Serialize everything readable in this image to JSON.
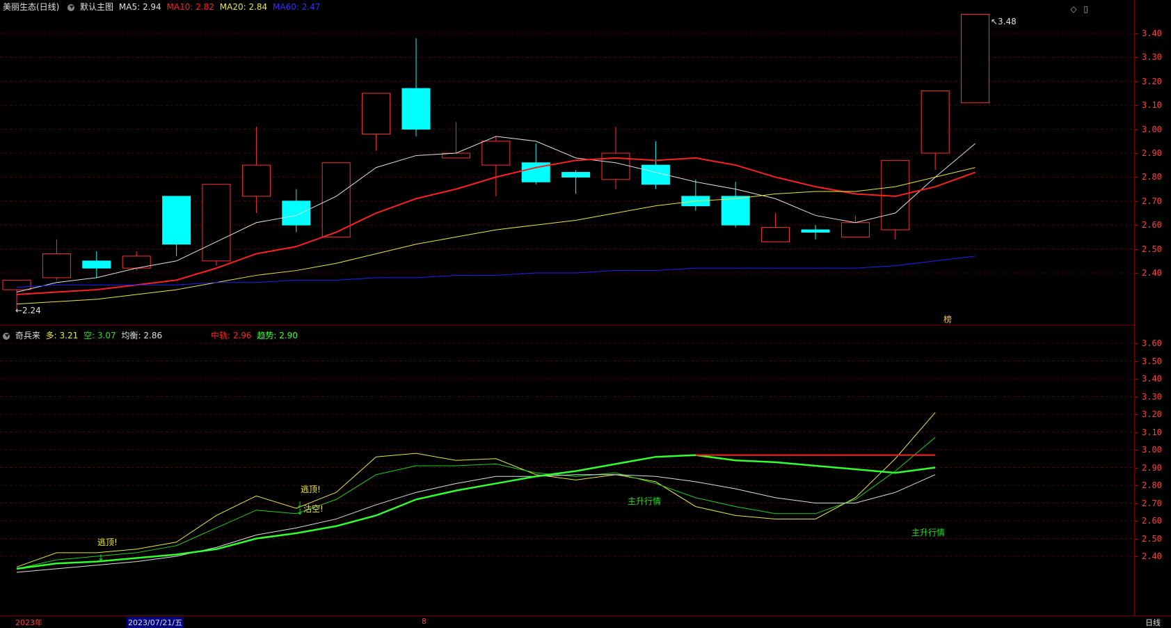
{
  "header": {
    "stock": "美丽生态(日线)",
    "template": "默认主图",
    "ma5_label": "MA5:",
    "ma5": "2.94",
    "ma10_label": "MA10:",
    "ma10": "2.82",
    "ma20_label": "MA20:",
    "ma20": "2.84",
    "ma60_label": "MA60:",
    "ma60": "2.47",
    "icons": [
      "diamond-icon",
      "window-icon"
    ]
  },
  "indicator_header": {
    "name": "奇兵来",
    "duo_label": "多:",
    "duo": "3.21",
    "kong_label": "空:",
    "kong": "3.07",
    "junheng_label": "均衡:",
    "junheng": "2.86",
    "zhonggui_label": "中轨:",
    "zhonggui": "2.96",
    "qushi_label": "趋势:",
    "qushi": "2.90"
  },
  "annotations": {
    "high_label": "3.48",
    "low_label": "2.24",
    "bang": "榜",
    "escape_top_1": "逃顶!",
    "escape_top_2": "逃顶!",
    "sell_short": "沽空!",
    "main_rise_1": "主升行情",
    "main_rise_2": "主升行情"
  },
  "footer": {
    "year": "2023年",
    "date": "2023/07/21/五",
    "month": "8",
    "period": "日线"
  },
  "colors": {
    "up": "#ff3030",
    "down": "#00ffff",
    "ma5": "#e0e0e0",
    "ma10": "#ff2020",
    "ma20": "#e8e840",
    "ma60": "#2020ff",
    "axis": "#ff4040"
  },
  "chart_data": [
    {
      "type": "candlestick",
      "ylim": [
        2.2,
        3.5
      ],
      "yticks": [
        "3.40",
        "3.30",
        "3.20",
        "3.10",
        "3.00",
        "2.90",
        "2.80",
        "2.70",
        "2.60",
        "2.50",
        "2.40"
      ],
      "candles": [
        {
          "o": 2.33,
          "h": 2.37,
          "l": 2.24,
          "c": 2.37
        },
        {
          "o": 2.38,
          "h": 2.54,
          "l": 2.37,
          "c": 2.48
        },
        {
          "o": 2.45,
          "h": 2.49,
          "l": 2.38,
          "c": 2.42
        },
        {
          "o": 2.42,
          "h": 2.49,
          "l": 2.41,
          "c": 2.47
        },
        {
          "o": 2.72,
          "h": 2.72,
          "l": 2.47,
          "c": 2.52
        },
        {
          "o": 2.45,
          "h": 2.77,
          "l": 2.43,
          "c": 2.77
        },
        {
          "o": 2.72,
          "h": 3.01,
          "l": 2.65,
          "c": 2.85
        },
        {
          "o": 2.7,
          "h": 2.75,
          "l": 2.57,
          "c": 2.6
        },
        {
          "o": 2.55,
          "h": 2.86,
          "l": 2.55,
          "c": 2.86
        },
        {
          "o": 2.98,
          "h": 3.15,
          "l": 2.91,
          "c": 3.15
        },
        {
          "o": 3.17,
          "h": 3.38,
          "l": 2.97,
          "c": 3.0
        },
        {
          "o": 2.88,
          "h": 3.03,
          "l": 2.88,
          "c": 2.9
        },
        {
          "o": 2.85,
          "h": 2.97,
          "l": 2.72,
          "c": 2.95
        },
        {
          "o": 2.86,
          "h": 2.94,
          "l": 2.77,
          "c": 2.78
        },
        {
          "o": 2.82,
          "h": 2.83,
          "l": 2.73,
          "c": 2.8
        },
        {
          "o": 2.79,
          "h": 3.01,
          "l": 2.75,
          "c": 2.9
        },
        {
          "o": 2.85,
          "h": 2.95,
          "l": 2.75,
          "c": 2.77
        },
        {
          "o": 2.72,
          "h": 2.79,
          "l": 2.66,
          "c": 2.68
        },
        {
          "o": 2.72,
          "h": 2.78,
          "l": 2.59,
          "c": 2.6
        },
        {
          "o": 2.53,
          "h": 2.65,
          "l": 2.53,
          "c": 2.59
        },
        {
          "o": 2.58,
          "h": 2.6,
          "l": 2.54,
          "c": 2.57
        },
        {
          "o": 2.55,
          "h": 2.64,
          "l": 2.55,
          "c": 2.61
        },
        {
          "o": 2.58,
          "h": 2.87,
          "l": 2.54,
          "c": 2.87
        },
        {
          "o": 2.9,
          "h": 3.16,
          "l": 2.83,
          "c": 3.16
        },
        {
          "o": 3.11,
          "h": 3.48,
          "l": 3.11,
          "c": 3.48
        }
      ],
      "series": [
        {
          "name": "MA5",
          "values": [
            2.32,
            2.36,
            2.38,
            2.42,
            2.45,
            2.53,
            2.61,
            2.64,
            2.72,
            2.84,
            2.89,
            2.9,
            2.97,
            2.95,
            2.88,
            2.86,
            2.82,
            2.78,
            2.75,
            2.71,
            2.64,
            2.61,
            2.65,
            2.8,
            2.94
          ]
        },
        {
          "name": "MA10",
          "values": [
            2.31,
            2.32,
            2.33,
            2.35,
            2.37,
            2.42,
            2.48,
            2.51,
            2.57,
            2.65,
            2.71,
            2.75,
            2.8,
            2.84,
            2.87,
            2.88,
            2.87,
            2.88,
            2.85,
            2.8,
            2.76,
            2.73,
            2.72,
            2.76,
            2.82
          ]
        },
        {
          "name": "MA20",
          "values": [
            2.27,
            2.28,
            2.29,
            2.31,
            2.33,
            2.36,
            2.39,
            2.41,
            2.44,
            2.48,
            2.52,
            2.55,
            2.58,
            2.6,
            2.62,
            2.65,
            2.68,
            2.7,
            2.71,
            2.73,
            2.74,
            2.74,
            2.76,
            2.8,
            2.84
          ]
        },
        {
          "name": "MA60",
          "values": [
            2.34,
            2.35,
            2.35,
            2.35,
            2.35,
            2.36,
            2.36,
            2.37,
            2.37,
            2.38,
            2.38,
            2.39,
            2.39,
            2.4,
            2.4,
            2.41,
            2.41,
            2.42,
            2.42,
            2.42,
            2.42,
            2.42,
            2.43,
            2.45,
            2.47
          ]
        }
      ]
    },
    {
      "type": "line",
      "ylim": [
        2.25,
        3.7
      ],
      "yticks": [
        "3.60",
        "3.50",
        "3.40",
        "3.30",
        "3.20",
        "3.10",
        "3.00",
        "2.90",
        "2.80",
        "2.70",
        "2.60",
        "2.50",
        "2.40"
      ],
      "series": [
        {
          "name": "多",
          "values": [
            2.34,
            2.42,
            2.42,
            2.44,
            2.48,
            2.63,
            2.74,
            2.67,
            2.76,
            2.96,
            2.98,
            2.94,
            2.95,
            2.86,
            2.83,
            2.86,
            2.82,
            2.68,
            2.63,
            2.61,
            2.61,
            2.73,
            2.95,
            3.21
          ]
        },
        {
          "name": "空",
          "values": [
            2.33,
            2.38,
            2.4,
            2.42,
            2.46,
            2.56,
            2.66,
            2.64,
            2.72,
            2.86,
            2.91,
            2.91,
            2.92,
            2.87,
            2.85,
            2.87,
            2.81,
            2.73,
            2.68,
            2.64,
            2.64,
            2.72,
            2.88,
            3.07
          ]
        },
        {
          "name": "均衡",
          "values": [
            2.31,
            2.33,
            2.35,
            2.37,
            2.4,
            2.45,
            2.52,
            2.56,
            2.61,
            2.69,
            2.76,
            2.81,
            2.85,
            2.85,
            2.86,
            2.86,
            2.85,
            2.82,
            2.78,
            2.73,
            2.7,
            2.7,
            2.76,
            2.86
          ]
        },
        {
          "name": "趋势",
          "values": [
            2.33,
            2.36,
            2.37,
            2.39,
            2.41,
            2.44,
            2.5,
            2.53,
            2.57,
            2.63,
            2.72,
            2.77,
            2.81,
            2.85,
            2.88,
            2.92,
            2.96,
            2.97,
            2.94,
            2.93,
            2.91,
            2.89,
            2.87,
            2.9
          ]
        },
        {
          "name": "中轨",
          "values": [
            null,
            null,
            null,
            null,
            null,
            null,
            null,
            null,
            null,
            null,
            null,
            null,
            null,
            null,
            null,
            null,
            null,
            2.97,
            2.97,
            2.97,
            2.97,
            2.97,
            2.97,
            2.97
          ]
        }
      ]
    }
  ]
}
